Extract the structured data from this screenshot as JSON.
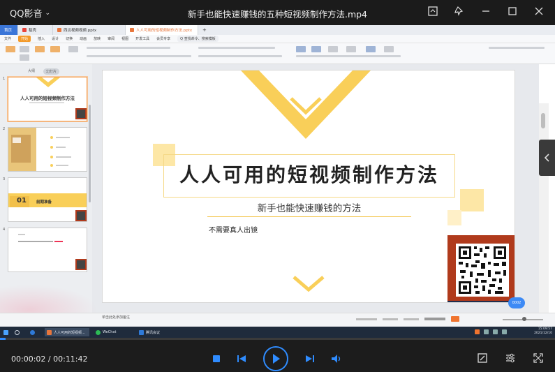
{
  "player": {
    "app_name": "QQ影音",
    "video_title": "新手也能快速赚钱的五种短视频制作方法.mp4",
    "current_time": "00:00:02",
    "separator": " / ",
    "total_time": "00:11:42",
    "progress_fraction": 0.003,
    "accent": "#2f8cff"
  },
  "wps": {
    "tabs": [
      {
        "label": "首页"
      },
      {
        "label": "稻壳"
      },
      {
        "label": "西瓜视频视频.pptx"
      },
      {
        "label": "人人可用的短视频制作方法.pptx"
      }
    ],
    "menu": [
      "文件",
      "开始",
      "插入",
      "设计",
      "切换",
      "动画",
      "放映",
      "审阅",
      "视图",
      "开发工具",
      "会员专享",
      "Q 查找命令、搜索模板"
    ],
    "panel_tabs": {
      "outline": "大纲",
      "slides": "幻灯片"
    },
    "thumb_numbers": [
      "1",
      "2",
      "3",
      "4"
    ],
    "thumb1_title": "人人可用的短视频制作方法",
    "thumb3_num": "01",
    "thumb3_text": "前期准备",
    "status_note": "单击此处添加备注",
    "page_badge": "0002"
  },
  "slide": {
    "title": "人人可用的短视频制作方法",
    "subtitle": "新手也能快速赚钱的方法",
    "note": "不需要真人出镜",
    "accent": "#f9cf59"
  },
  "taskbar": {
    "items": [
      "人人可用的短视频...",
      "WeChat",
      "腾讯会议"
    ],
    "time": "15:09:57",
    "date": "2021/12/10"
  }
}
